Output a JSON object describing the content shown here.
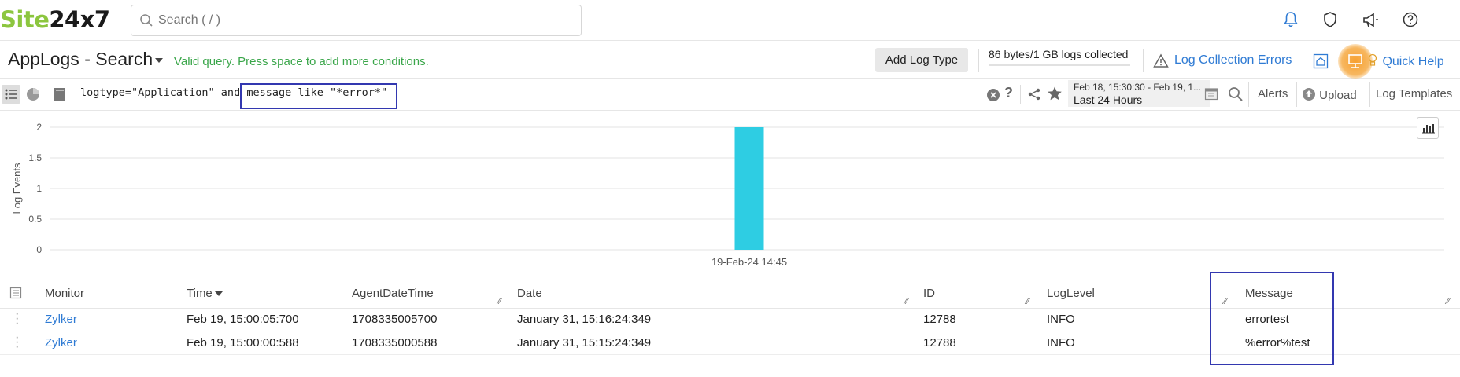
{
  "brand": {
    "part1": "Site",
    "part2": "24x7"
  },
  "search": {
    "placeholder": "Search ( / )"
  },
  "top_icons": [
    "bell-icon",
    "shield-icon",
    "megaphone-icon",
    "help-icon"
  ],
  "header": {
    "title": "AppLogs - Search",
    "valid_message": "Valid query. Press space to add more conditions.",
    "add_log_type": "Add Log Type",
    "logs_collected": "86 bytes/1 GB logs collected",
    "logs_collected_fraction": 1e-07,
    "log_collection_errors": "Log Collection Errors",
    "quick_help": "Quick Help"
  },
  "query": {
    "text_part1": "logtype=\"Application\" and ",
    "text_part2": "message like \"*error*\""
  },
  "time_range": {
    "range": "Feb 18, 15:30:30 - Feb 19, 1...",
    "label": "Last 24 Hours"
  },
  "toolbar": {
    "alerts": "Alerts",
    "upload": "Upload",
    "log_templates": "Log Templates"
  },
  "chart_data": {
    "type": "bar",
    "categories": [
      "19-Feb-24 14:45"
    ],
    "values": [
      2
    ],
    "ylabel": "Log Events",
    "ylim": [
      0,
      2
    ],
    "yticks": [
      "2",
      "1.5",
      "1",
      "0.5",
      "0"
    ],
    "bar_color": "#2ecde3",
    "grid": true
  },
  "table": {
    "columns": [
      "Monitor",
      "Time",
      "AgentDateTime",
      "Date",
      "ID",
      "LogLevel",
      "Message"
    ],
    "rows": [
      [
        "Zylker",
        "Feb 19, 15:00:05:700",
        "1708335005700",
        "January 31, 15:16:24:349",
        "12788",
        "INFO",
        "errortest"
      ],
      [
        "Zylker",
        "Feb 19, 15:00:00:588",
        "1708335000588",
        "January 31, 15:15:24:349",
        "12788",
        "INFO",
        "%error%test"
      ]
    ]
  },
  "colors": {
    "accent": "#2f7bd4",
    "valid": "#3aa64a",
    "highlight_box": "#3338b0"
  }
}
